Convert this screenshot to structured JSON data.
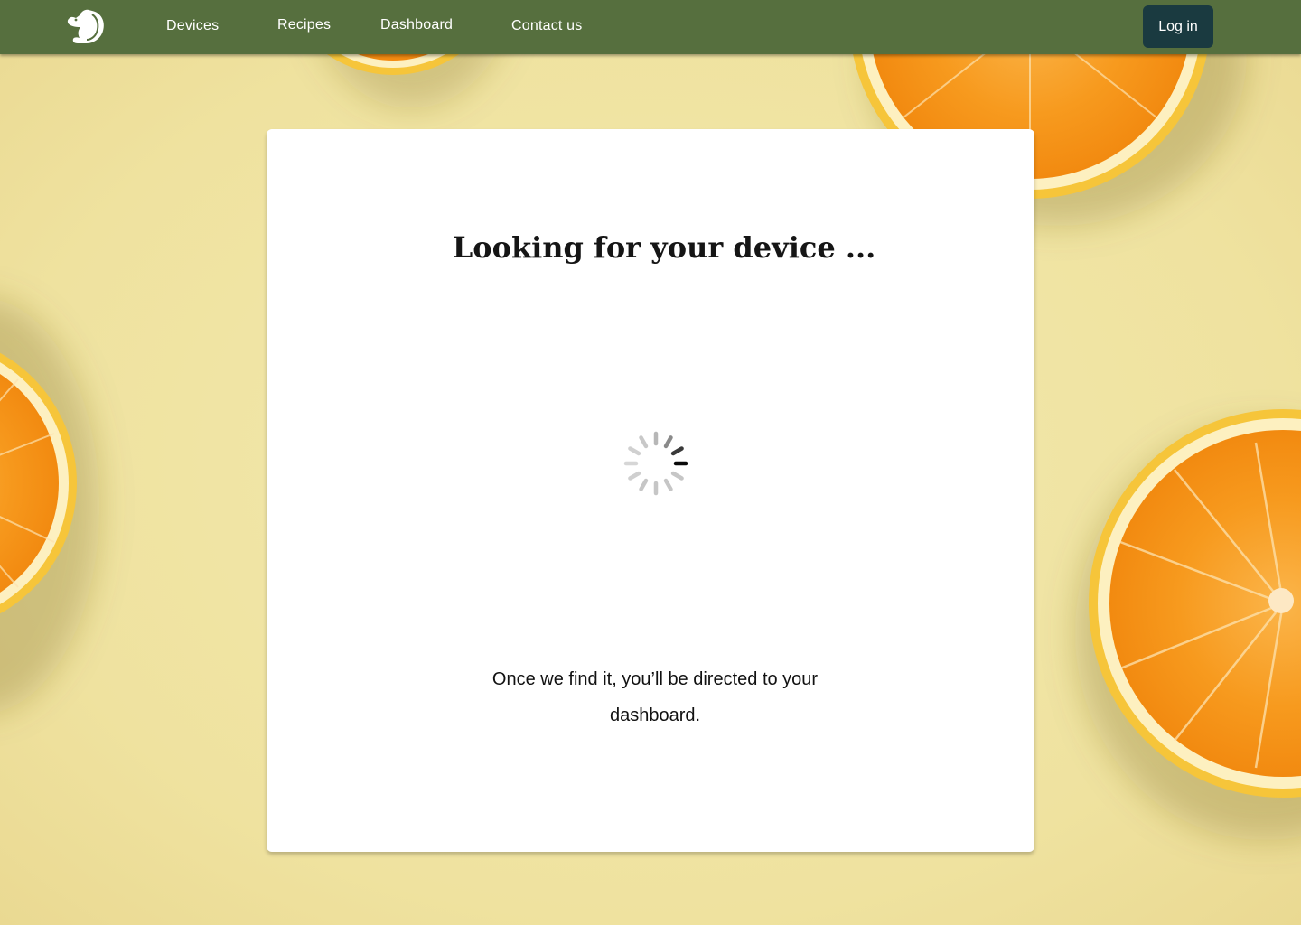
{
  "nav": {
    "logo_icon": "squirrel-logo-icon",
    "links": [
      "Devices",
      "Recipes",
      "Dashboard",
      "Contact us"
    ],
    "login_label": "Log in"
  },
  "card": {
    "title": "Looking for your device ...",
    "loading_icon": "loading-spinner-icon",
    "message": "Once we find it, you’ll be directed to your dashboard."
  },
  "colors": {
    "navbar": "#566f3e",
    "login_button": "#1a3a40",
    "background": "#f0e6a6",
    "orange_flesh": "#f7941d",
    "orange_rind": "#fbc02d"
  }
}
